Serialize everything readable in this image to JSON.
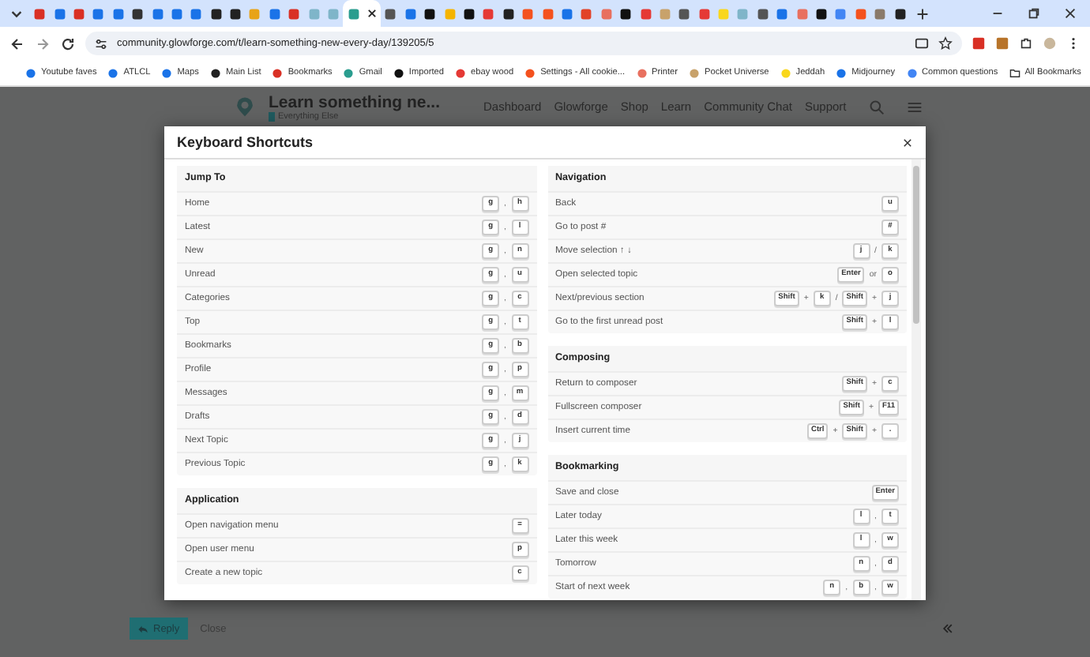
{
  "browser": {
    "tabs": [
      {
        "selected": false
      },
      {
        "selected": false
      },
      {
        "selected": false
      },
      {
        "selected": false
      },
      {
        "selected": false
      },
      {
        "selected": false
      },
      {
        "selected": false
      },
      {
        "selected": false
      },
      {
        "selected": false
      },
      {
        "selected": false
      },
      {
        "selected": false
      },
      {
        "selected": false
      },
      {
        "selected": false
      },
      {
        "selected": false
      },
      {
        "selected": false
      },
      {
        "selected": false
      },
      {
        "selected": true
      },
      {
        "selected": false
      },
      {
        "selected": false
      },
      {
        "selected": false
      },
      {
        "selected": false
      },
      {
        "selected": false
      },
      {
        "selected": false
      },
      {
        "selected": false
      },
      {
        "selected": false
      },
      {
        "selected": false
      },
      {
        "selected": false
      },
      {
        "selected": false
      },
      {
        "selected": false
      },
      {
        "selected": false
      },
      {
        "selected": false
      },
      {
        "selected": false
      },
      {
        "selected": false
      },
      {
        "selected": false
      },
      {
        "selected": false
      },
      {
        "selected": false
      },
      {
        "selected": false
      },
      {
        "selected": false
      },
      {
        "selected": false
      },
      {
        "selected": false
      },
      {
        "selected": false
      },
      {
        "selected": false
      },
      {
        "selected": false
      },
      {
        "selected": false
      }
    ],
    "address": "community.glowforge.com/t/learn-something-new-every-day/139205/5",
    "bookmarks": [
      "Youtube faves",
      "ATLCL",
      "Maps",
      "Main List",
      "Bookmarks",
      "Gmail",
      "Imported",
      "ebay wood",
      "Settings - All cookie...",
      "Printer",
      "Pocket Universe",
      "Jeddah",
      "Midjourney",
      "Common questions"
    ],
    "all_bookmarks": "All Bookmarks"
  },
  "site_header": {
    "title": "Learn something ne...",
    "category": "Everything Else",
    "nav": [
      "Dashboard",
      "Glowforge",
      "Shop",
      "Learn",
      "Community Chat",
      "Support"
    ]
  },
  "modal": {
    "title": "Keyboard Shortcuts",
    "columns": [
      [
        {
          "heading": "Jump To",
          "rows": [
            {
              "label": "Home",
              "keys": [
                {
                  "kind": "key",
                  "text": "g"
                },
                {
                  "kind": "sep",
                  "text": ","
                },
                {
                  "kind": "key",
                  "text": "h"
                }
              ]
            },
            {
              "label": "Latest",
              "keys": [
                {
                  "kind": "key",
                  "text": "g"
                },
                {
                  "kind": "sep",
                  "text": ","
                },
                {
                  "kind": "key",
                  "text": "l"
                }
              ]
            },
            {
              "label": "New",
              "keys": [
                {
                  "kind": "key",
                  "text": "g"
                },
                {
                  "kind": "sep",
                  "text": ","
                },
                {
                  "kind": "key",
                  "text": "n"
                }
              ]
            },
            {
              "label": "Unread",
              "keys": [
                {
                  "kind": "key",
                  "text": "g"
                },
                {
                  "kind": "sep",
                  "text": ","
                },
                {
                  "kind": "key",
                  "text": "u"
                }
              ]
            },
            {
              "label": "Categories",
              "keys": [
                {
                  "kind": "key",
                  "text": "g"
                },
                {
                  "kind": "sep",
                  "text": ","
                },
                {
                  "kind": "key",
                  "text": "c"
                }
              ]
            },
            {
              "label": "Top",
              "keys": [
                {
                  "kind": "key",
                  "text": "g"
                },
                {
                  "kind": "sep",
                  "text": ","
                },
                {
                  "kind": "key",
                  "text": "t"
                }
              ]
            },
            {
              "label": "Bookmarks",
              "keys": [
                {
                  "kind": "key",
                  "text": "g"
                },
                {
                  "kind": "sep",
                  "text": ","
                },
                {
                  "kind": "key",
                  "text": "b"
                }
              ]
            },
            {
              "label": "Profile",
              "keys": [
                {
                  "kind": "key",
                  "text": "g"
                },
                {
                  "kind": "sep",
                  "text": ","
                },
                {
                  "kind": "key",
                  "text": "p"
                }
              ]
            },
            {
              "label": "Messages",
              "keys": [
                {
                  "kind": "key",
                  "text": "g"
                },
                {
                  "kind": "sep",
                  "text": ","
                },
                {
                  "kind": "key",
                  "text": "m"
                }
              ]
            },
            {
              "label": "Drafts",
              "keys": [
                {
                  "kind": "key",
                  "text": "g"
                },
                {
                  "kind": "sep",
                  "text": ","
                },
                {
                  "kind": "key",
                  "text": "d"
                }
              ]
            },
            {
              "label": "Next Topic",
              "keys": [
                {
                  "kind": "key",
                  "text": "g"
                },
                {
                  "kind": "sep",
                  "text": ","
                },
                {
                  "kind": "key",
                  "text": "j"
                }
              ]
            },
            {
              "label": "Previous Topic",
              "keys": [
                {
                  "kind": "key",
                  "text": "g"
                },
                {
                  "kind": "sep",
                  "text": ","
                },
                {
                  "kind": "key",
                  "text": "k"
                }
              ]
            }
          ]
        },
        {
          "heading": "Application",
          "rows": [
            {
              "label": "Open navigation menu",
              "keys": [
                {
                  "kind": "key",
                  "text": "="
                }
              ]
            },
            {
              "label": "Open user menu",
              "keys": [
                {
                  "kind": "key",
                  "text": "p"
                }
              ]
            },
            {
              "label": "Create a new topic",
              "keys": [
                {
                  "kind": "key",
                  "text": "c"
                }
              ]
            }
          ]
        }
      ],
      [
        {
          "heading": "Navigation",
          "rows": [
            {
              "label": "Back",
              "keys": [
                {
                  "kind": "key",
                  "text": "u"
                }
              ]
            },
            {
              "label": "Go to post #",
              "keys": [
                {
                  "kind": "key",
                  "text": "#"
                }
              ]
            },
            {
              "label": "Move selection ↑ ↓",
              "keys": [
                {
                  "kind": "key",
                  "text": "j"
                },
                {
                  "kind": "sep",
                  "text": "/"
                },
                {
                  "kind": "key",
                  "text": "k"
                }
              ]
            },
            {
              "label": "Open selected topic",
              "keys": [
                {
                  "kind": "key",
                  "text": "Enter"
                },
                {
                  "kind": "sep",
                  "text": "or"
                },
                {
                  "kind": "key",
                  "text": "o"
                }
              ]
            },
            {
              "label": "Next/previous section",
              "keys": [
                {
                  "kind": "key",
                  "text": "Shift"
                },
                {
                  "kind": "sep",
                  "text": "+"
                },
                {
                  "kind": "key",
                  "text": "k"
                },
                {
                  "kind": "sep",
                  "text": "/"
                },
                {
                  "kind": "key",
                  "text": "Shift"
                },
                {
                  "kind": "sep",
                  "text": "+"
                },
                {
                  "kind": "key",
                  "text": "j"
                }
              ]
            },
            {
              "label": "Go to the first unread post",
              "keys": [
                {
                  "kind": "key",
                  "text": "Shift"
                },
                {
                  "kind": "sep",
                  "text": "+"
                },
                {
                  "kind": "key",
                  "text": "l"
                }
              ]
            }
          ]
        },
        {
          "heading": "Composing",
          "rows": [
            {
              "label": "Return to composer",
              "keys": [
                {
                  "kind": "key",
                  "text": "Shift"
                },
                {
                  "kind": "sep",
                  "text": "+"
                },
                {
                  "kind": "key",
                  "text": "c"
                }
              ]
            },
            {
              "label": "Fullscreen composer",
              "keys": [
                {
                  "kind": "key",
                  "text": "Shift"
                },
                {
                  "kind": "sep",
                  "text": "+"
                },
                {
                  "kind": "key",
                  "text": "F11"
                }
              ]
            },
            {
              "label": "Insert current time",
              "keys": [
                {
                  "kind": "key",
                  "text": "Ctrl"
                },
                {
                  "kind": "sep",
                  "text": "+"
                },
                {
                  "kind": "key",
                  "text": "Shift"
                },
                {
                  "kind": "sep",
                  "text": "+"
                },
                {
                  "kind": "key",
                  "text": "."
                }
              ]
            }
          ]
        },
        {
          "heading": "Bookmarking",
          "rows": [
            {
              "label": "Save and close",
              "keys": [
                {
                  "kind": "key",
                  "text": "Enter"
                }
              ]
            },
            {
              "label": "Later today",
              "keys": [
                {
                  "kind": "key",
                  "text": "l"
                },
                {
                  "kind": "sep",
                  "text": ","
                },
                {
                  "kind": "key",
                  "text": "t"
                }
              ]
            },
            {
              "label": "Later this week",
              "keys": [
                {
                  "kind": "key",
                  "text": "l"
                },
                {
                  "kind": "sep",
                  "text": ","
                },
                {
                  "kind": "key",
                  "text": "w"
                }
              ]
            },
            {
              "label": "Tomorrow",
              "keys": [
                {
                  "kind": "key",
                  "text": "n"
                },
                {
                  "kind": "sep",
                  "text": ","
                },
                {
                  "kind": "key",
                  "text": "d"
                }
              ]
            },
            {
              "label": "Start of next week",
              "keys": [
                {
                  "kind": "key",
                  "text": "n"
                },
                {
                  "kind": "sep",
                  "text": ","
                },
                {
                  "kind": "key",
                  "text": "b"
                },
                {
                  "kind": "sep",
                  "text": ","
                },
                {
                  "kind": "key",
                  "text": "w"
                }
              ]
            }
          ]
        }
      ]
    ]
  },
  "footer": {
    "reply": "Reply",
    "close": "Close"
  }
}
